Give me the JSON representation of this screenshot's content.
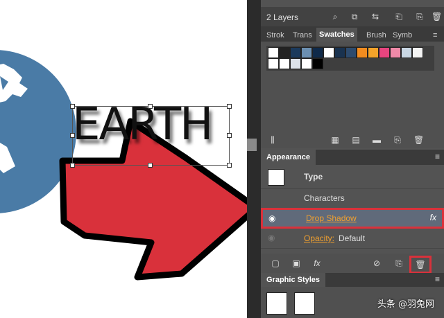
{
  "canvas": {
    "artwork_text": "EARTH",
    "colors": {
      "globe": "#4a7ba6",
      "arrow": "#d9313b",
      "arrow_outline": "#000000"
    }
  },
  "layers": {
    "count_label": "2 Layers",
    "icons": [
      "search-icon",
      "locate-object-icon",
      "make-clipping-mask-icon",
      "new-sublayer-icon",
      "new-layer-icon",
      "trash-icon"
    ]
  },
  "tabs": [
    {
      "label": "Strok",
      "active": false
    },
    {
      "label": "Trans",
      "active": false
    },
    {
      "label": "Swatches",
      "active": true
    },
    {
      "label": "Brush",
      "active": false
    },
    {
      "label": "Symb",
      "active": false
    }
  ],
  "swatches": {
    "row1": [
      "#ffffff",
      "#222222",
      "#1b3a5c",
      "#6b8fb1",
      "#0f2a4a",
      "#ffffff",
      "#19324f",
      "#2d4b6e",
      "#f28c1f",
      "#f4a32a",
      "#e8457f",
      "#f08aa8",
      "#c9d6e3",
      "#f4f4f4"
    ],
    "row2": [
      "#ffffff",
      "#ffffff",
      "#dde3ea",
      "#ffffff",
      "#000000"
    ]
  },
  "appearance": {
    "title": "Appearance",
    "object_type": "Type",
    "items": [
      {
        "label": "Characters"
      },
      {
        "label": "Drop Shadow",
        "fx": "fx",
        "selected": true
      },
      {
        "label": "Opacity:",
        "value": "Default"
      }
    ],
    "footer_icons": [
      "add-stroke-icon",
      "add-fill-icon",
      "fx-icon",
      "clear-appearance-icon",
      "duplicate-item-icon",
      "trash-icon"
    ],
    "accent": "#f0a030",
    "highlight": "#d9313b"
  },
  "graphic_styles": {
    "title": "Graphic Styles"
  },
  "watermark": "头条 @羽兔网"
}
